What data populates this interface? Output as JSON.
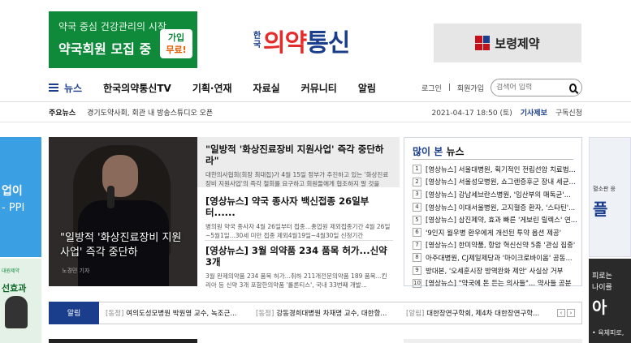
{
  "top_ad_left": {
    "line1": "약국 중심 건강관리의 시작",
    "line2": "약국회원 모집 중",
    "badge1": "가입",
    "badge2": "무료!"
  },
  "logo": {
    "small": "한국",
    "big_a": "의약",
    "big_b": "통신"
  },
  "top_ad_right": {
    "name": "보령제약"
  },
  "nav": {
    "items": [
      "뉴스",
      "한국의약통신TV",
      "기획·연재",
      "자료실",
      "커뮤니티",
      "알림"
    ],
    "login": "로그인",
    "join": "회원가입",
    "search_placeholder": "검색어 입력"
  },
  "subbar": {
    "label": "주요뉴스",
    "headline": "경기도약사회, 회관 내 방송스튜디오 오픈",
    "datetime": "2021-04-17 18:50 (토)",
    "report": "기사제보",
    "subscribe": "구독신청"
  },
  "side_left": {
    "t1": "업이",
    "t2": "- PPI",
    "brand": "대원제약",
    "t3": "선효과"
  },
  "side_right": {
    "s": "혈소판 응",
    "b": "플",
    "a": "피로는",
    "b2": "나이를",
    "c": "아",
    "d": "• 육체피로,"
  },
  "hero": {
    "caption": "\"일방적 '화상진료장비 지원사업' 즉각 중단하",
    "credit": "노경민 기자"
  },
  "stories": [
    {
      "title": "\"일방적 '화상진료장비 지원사업' 즉각 중단하라\"",
      "summary": "대한의사협회(회장 최대집)가 4월 15일 정부가 추진하고 있는 '화상진료장비 지원사업'의 즉각 철회를 요구하고 회원들에게 협조하지 말 것을"
    },
    {
      "title": "[영상뉴스] 약국 종사자 백신접종 26일부터......",
      "summary": "병의원 약국 종사자 4월 26일부터 접종...총업원 제외접종기간 4월 26일 ~5월1일...30세 미만 접종 제외4월19일~4월30일 신청기간"
    },
    {
      "title": "[영상뉴스] 3월 의약품 234 품목 허가...신약 3개",
      "summary": "3월 완제의약품 234 품목 허가...취하 211개전문의약품 189 품목...킨리아 등 신약 3개 포함한의약품 '롤론티스', 국내 33번째 개발..."
    }
  ],
  "popular": {
    "head_a": "많이 본",
    "head_b": " 뉴스",
    "items": [
      "[영상뉴스] 서울대병원, 획기적인 전립선암 치료법...",
      "[영상뉴스] 서울성모병원, 쇼그렌증후군 장내 세균...",
      "[영상뉴스] 강남세브란스병원, '임산부의 매독균'...",
      "[영상뉴스] 이대서울병원, 고지혈증 환자, '스타틴'...",
      "[영상뉴스] 삼진제약, 효과 빠른 '게보린 릴렉스' 연...",
      "'9인지 월우병 환우에게 개선된 투약 옵션 제공'",
      "[영상뉴스] 한미약품, 항암 혁신신약 5종 '관심 집중'",
      "아주대병원, CJ제일제당과 '마이크로바이옴' 공동...",
      "방대본, '오세훈시장 방역완화 제안' 사실상 거부",
      "[영상뉴스] \"약국에 돈 든는 의사들\"... 약사들 공분"
    ]
  },
  "ticker": {
    "label": "알림",
    "items": [
      {
        "cat": "[동정]",
        "text": "여의도성모병원 박원영 교수, 녹조근..."
      },
      {
        "cat": "[동정]",
        "text": "강동경희대병원 차재명 교수, 대한항..."
      },
      {
        "cat": "[알림]",
        "text": "대한장연구학회, 제4차 대한장연구학..."
      }
    ],
    "prev": "‹",
    "next": "›"
  }
}
